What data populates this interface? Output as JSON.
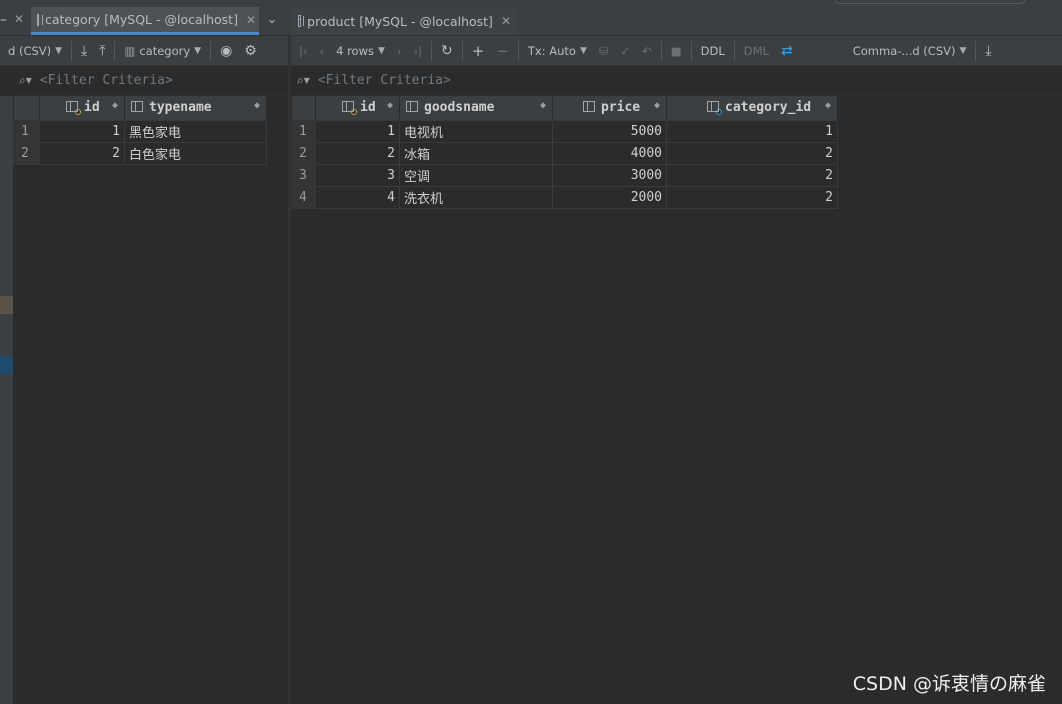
{
  "tabs": [
    {
      "label": "category [MySQL - @localhost]",
      "active": true
    },
    {
      "label": "product [MySQL - @localhost]",
      "active": false
    }
  ],
  "left_toolbar": {
    "export_format": "d (CSV)",
    "table_select": "category"
  },
  "right_toolbar": {
    "rows": "4 rows",
    "tx": "Tx: Auto",
    "ddl": "DDL",
    "dml": "DML",
    "export_format": "Comma-...d (CSV)"
  },
  "filter_placeholder": "<Filter Criteria>",
  "category_table": {
    "columns": [
      "id",
      "typename"
    ],
    "rows": [
      {
        "rownum": "1",
        "id": "1",
        "typename": "黑色家电"
      },
      {
        "rownum": "2",
        "id": "2",
        "typename": "白色家电"
      }
    ]
  },
  "product_table": {
    "columns": [
      "id",
      "goodsname",
      "price",
      "category_id"
    ],
    "rows": [
      {
        "rownum": "1",
        "id": "1",
        "goodsname": "电视机",
        "price": "5000",
        "category_id": "1"
      },
      {
        "rownum": "2",
        "id": "2",
        "goodsname": "冰箱",
        "price": "4000",
        "category_id": "2"
      },
      {
        "rownum": "3",
        "id": "3",
        "goodsname": "空调",
        "price": "3000",
        "category_id": "2"
      },
      {
        "rownum": "4",
        "id": "4",
        "goodsname": "洗衣机",
        "price": "2000",
        "category_id": "2"
      }
    ]
  },
  "watermark": "CSDN @诉衷情の麻雀",
  "icons": [
    "table-icon",
    "close-icon",
    "chevron-down-icon",
    "download-icon",
    "upload-icon",
    "eye-icon",
    "gear-icon",
    "first-page-icon",
    "prev-page-icon",
    "next-page-icon",
    "last-page-icon",
    "refresh-icon",
    "plus-icon",
    "minus-icon",
    "check-icon",
    "revert-icon",
    "stop-icon",
    "compare-icon",
    "search-icon",
    "primary-key-icon",
    "column-icon",
    "sort-icon"
  ],
  "colors": {
    "background": "#2b2b2b",
    "panel": "#3c3f41",
    "accent": "#4a88c7"
  }
}
